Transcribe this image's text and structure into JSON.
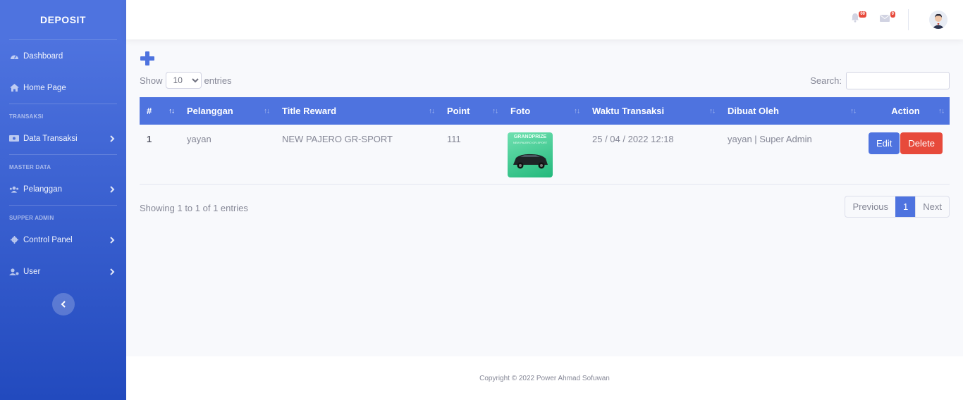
{
  "sidebar": {
    "brand": "DEPOSIT",
    "items": [
      {
        "label": "Dashboard",
        "icon": "tachometer-icon"
      },
      {
        "label": "Home Page",
        "icon": "home-icon"
      }
    ],
    "headings": [
      "TRANSAKSI",
      "MASTER DATA",
      "SUPPER ADMIN"
    ],
    "transaksi_items": [
      {
        "label": "Data Transaksi",
        "icon": "money-bill-icon"
      }
    ],
    "master_items": [
      {
        "label": "Pelanggan",
        "icon": "users-icon"
      }
    ],
    "admin_items": [
      {
        "label": "Control Panel",
        "icon": "gear-icon"
      },
      {
        "label": "User",
        "icon": "user-cog-icon"
      }
    ]
  },
  "topbar": {
    "alerts_badge": "00",
    "messages_badge": "0"
  },
  "table_controls": {
    "show_label": "Show",
    "entries_label": "entries",
    "page_size": "10",
    "search_label": "Search:"
  },
  "table": {
    "headers": [
      "#",
      "Pelanggan",
      "Title Reward",
      "Point",
      "Foto",
      "Waktu Transaksi",
      "Dibuat Oleh",
      "Action"
    ],
    "rows": [
      {
        "no": "1",
        "pelanggan": "yayan",
        "title_reward": "NEW PAJERO GR-SPORT",
        "point": "111",
        "foto_caption": "GRANDPRIZE",
        "foto_subcaption": "NEW PAJERO GR-SPORT",
        "waktu": "25 / 04 / 2022 12:18",
        "dibuat_oleh": "yayan | Super Admin"
      }
    ],
    "edit_label": "Edit",
    "delete_label": "Delete"
  },
  "pagination": {
    "info": "Showing 1 to 1 of 1 entries",
    "previous": "Previous",
    "current": "1",
    "next": "Next"
  },
  "footer": {
    "copyright": "Copyright © 2022 Power Ahmad Sofuwan"
  },
  "colors": {
    "primary": "#4e73df",
    "danger": "#e74a3b",
    "sidebar_end": "#224abe"
  }
}
